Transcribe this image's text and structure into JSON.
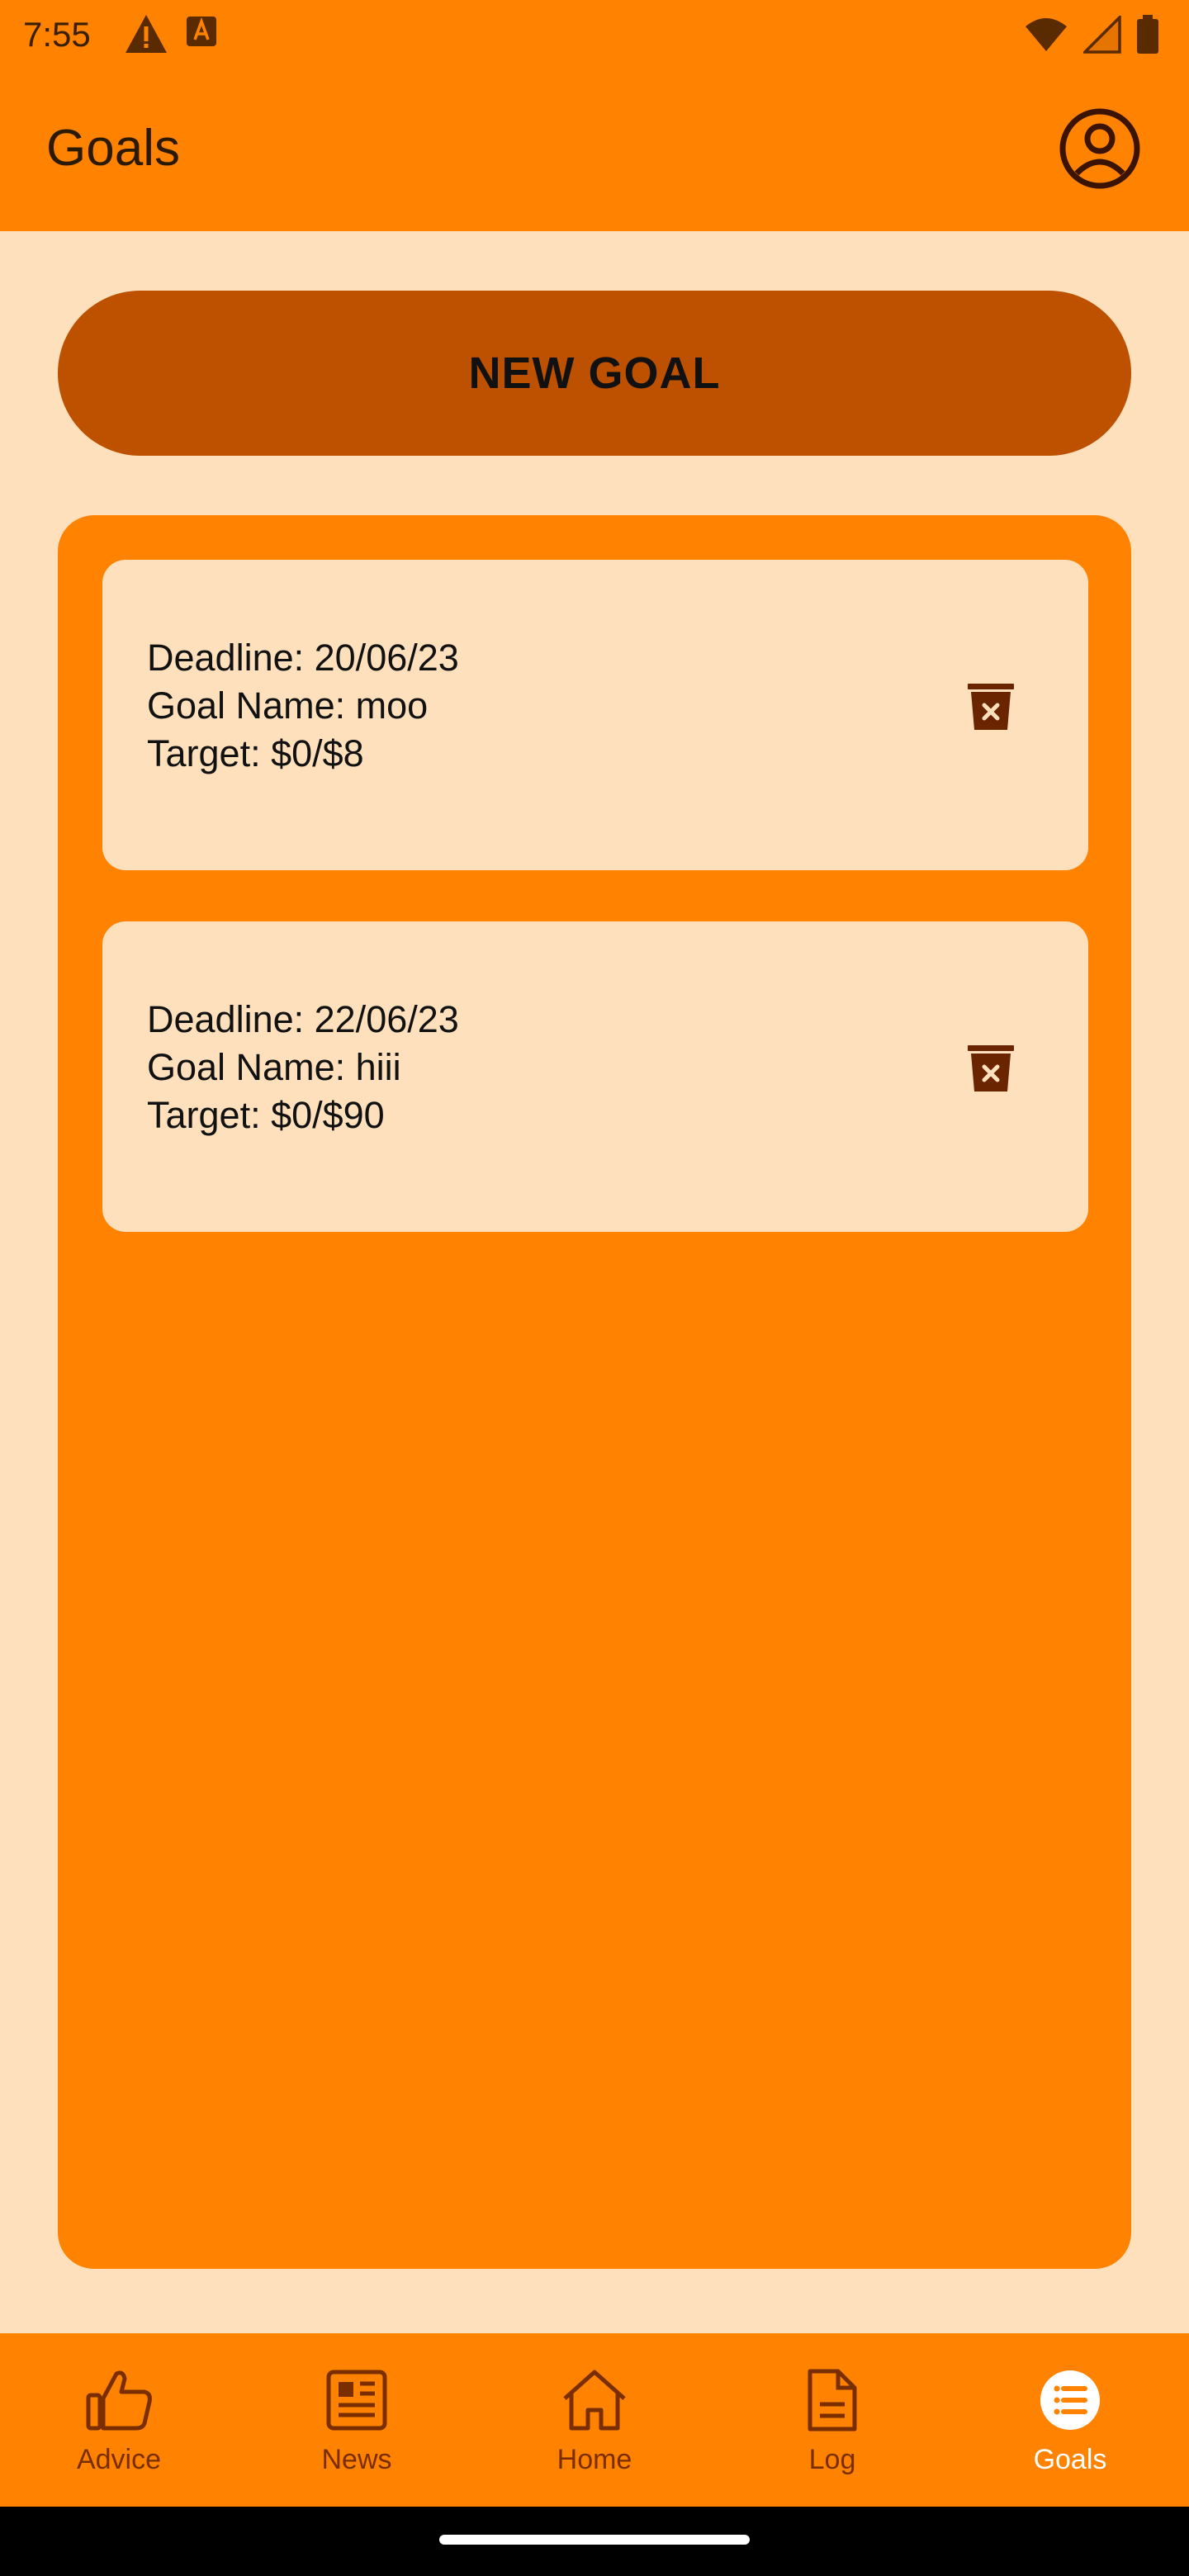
{
  "status_bar": {
    "time": "7:55",
    "left_icons": [
      "alert-icon",
      "keyboard-a-icon"
    ],
    "right_icons": [
      "wifi-icon",
      "signal-icon",
      "battery-icon"
    ]
  },
  "app_bar": {
    "title": "Goals",
    "profile_icon": "account-circle-icon"
  },
  "new_goal_button": {
    "label": "NEW GOAL"
  },
  "goals": [
    {
      "deadline": "Deadline: 20/06/23",
      "name": "Goal Name: moo",
      "target": "Target: $0/$8"
    },
    {
      "deadline": "Deadline: 22/06/23",
      "name": "Goal Name: hiii",
      "target": "Target: $0/$90"
    }
  ],
  "bottom_nav": {
    "items": [
      {
        "label": "Advice",
        "icon": "thumbs-up-icon",
        "active": false
      },
      {
        "label": "News",
        "icon": "newspaper-icon",
        "active": false
      },
      {
        "label": "Home",
        "icon": "home-icon",
        "active": false
      },
      {
        "label": "Log",
        "icon": "document-icon",
        "active": false
      },
      {
        "label": "Goals",
        "icon": "list-circle-icon",
        "active": true
      }
    ]
  },
  "colors": {
    "primary": "#FF8200",
    "background": "#FFE0BC",
    "button": "#BD5100",
    "icon_dark": "#7A2E00",
    "card_icon": "#6B2400"
  }
}
